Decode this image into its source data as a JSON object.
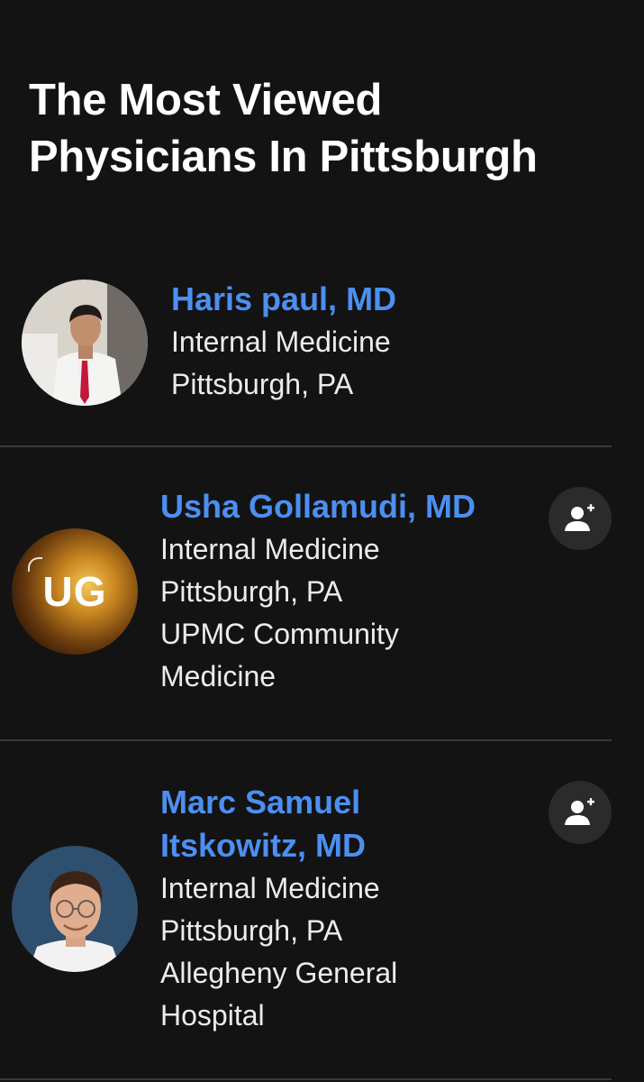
{
  "header": {
    "title_line1": "The Most Viewed",
    "title_line2": "Physicians In Pittsburgh"
  },
  "physicians": [
    {
      "name": "Haris paul, MD",
      "specialty": "Internal Medicine",
      "location": "Pittsburgh, PA",
      "avatar": "photo"
    },
    {
      "name": "Usha Gollamudi, MD",
      "specialty": "Internal Medicine",
      "location": "Pittsburgh, PA",
      "affiliation_line1": "UPMC Community",
      "affiliation_line2": "Medicine",
      "avatar_initials": "UG",
      "follow_icon": "add-person-icon"
    },
    {
      "name_line1": "Marc Samuel",
      "name_line2": "Itskowitz, MD",
      "specialty": "Internal Medicine",
      "location": "Pittsburgh, PA",
      "affiliation_line1": "Allegheny General",
      "affiliation_line2": "Hospital",
      "avatar": "photo",
      "follow_icon": "add-person-icon"
    }
  ],
  "colors": {
    "background": "#131313",
    "name_link": "#4c8ff2",
    "text": "#ececec",
    "divider": "#3a3a3a",
    "button_bg": "#2b2b2b"
  }
}
